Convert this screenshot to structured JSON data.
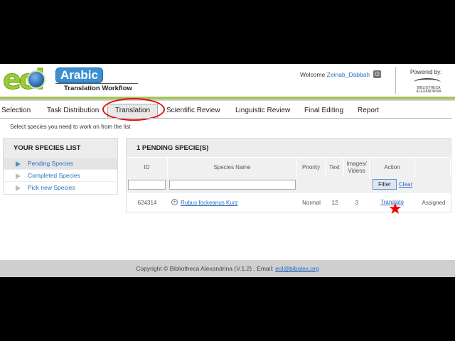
{
  "header": {
    "logo_text": "eol",
    "logo_badge": "Arabic",
    "subtitle": "Translation Workflow",
    "welcome_label": "Welcome",
    "user_name": "Zeinab_Dabbah",
    "powered_by": "Powered by:",
    "partner_logo_caption": "BIBLIOTHECA ALEXANDRINA"
  },
  "tabs": [
    {
      "label": "Selection"
    },
    {
      "label": "Task Distribution"
    },
    {
      "label": "Translation",
      "active": true
    },
    {
      "label": "Scientific Review"
    },
    {
      "label": "Linguistic Review"
    },
    {
      "label": "Final Editing"
    },
    {
      "label": "Report"
    }
  ],
  "instruction": "Select species you need to work on from the list",
  "species_list": {
    "title": "YOUR SPECIES LIST",
    "items": [
      {
        "label": "Pending Species",
        "current": true
      },
      {
        "label": "Completed Species"
      },
      {
        "label": "Pick new Species"
      }
    ]
  },
  "pending": {
    "title": "1 PENDING SPECIE(S)",
    "columns": [
      "ID",
      "Species Name",
      "Priority",
      "Text",
      "Images/ Videos",
      "Action",
      ""
    ],
    "filter_label": "Filter",
    "clear_label": "Clear",
    "rows": [
      {
        "id": "624314",
        "name": "Rubus fockeanus Kurz",
        "priority": "Normal",
        "text": "12",
        "media": "3",
        "action": "Translate",
        "status": "Assigned"
      }
    ]
  },
  "footer": {
    "copyright": "Copyright © Bibliotheca Alexandrina (V.1.2) , Email: ",
    "email": "eol@bibalex.org"
  },
  "colors": {
    "accent": "#2a6ebf",
    "logo_green": "#9acd32",
    "highlight_ring": "#dd1111"
  }
}
